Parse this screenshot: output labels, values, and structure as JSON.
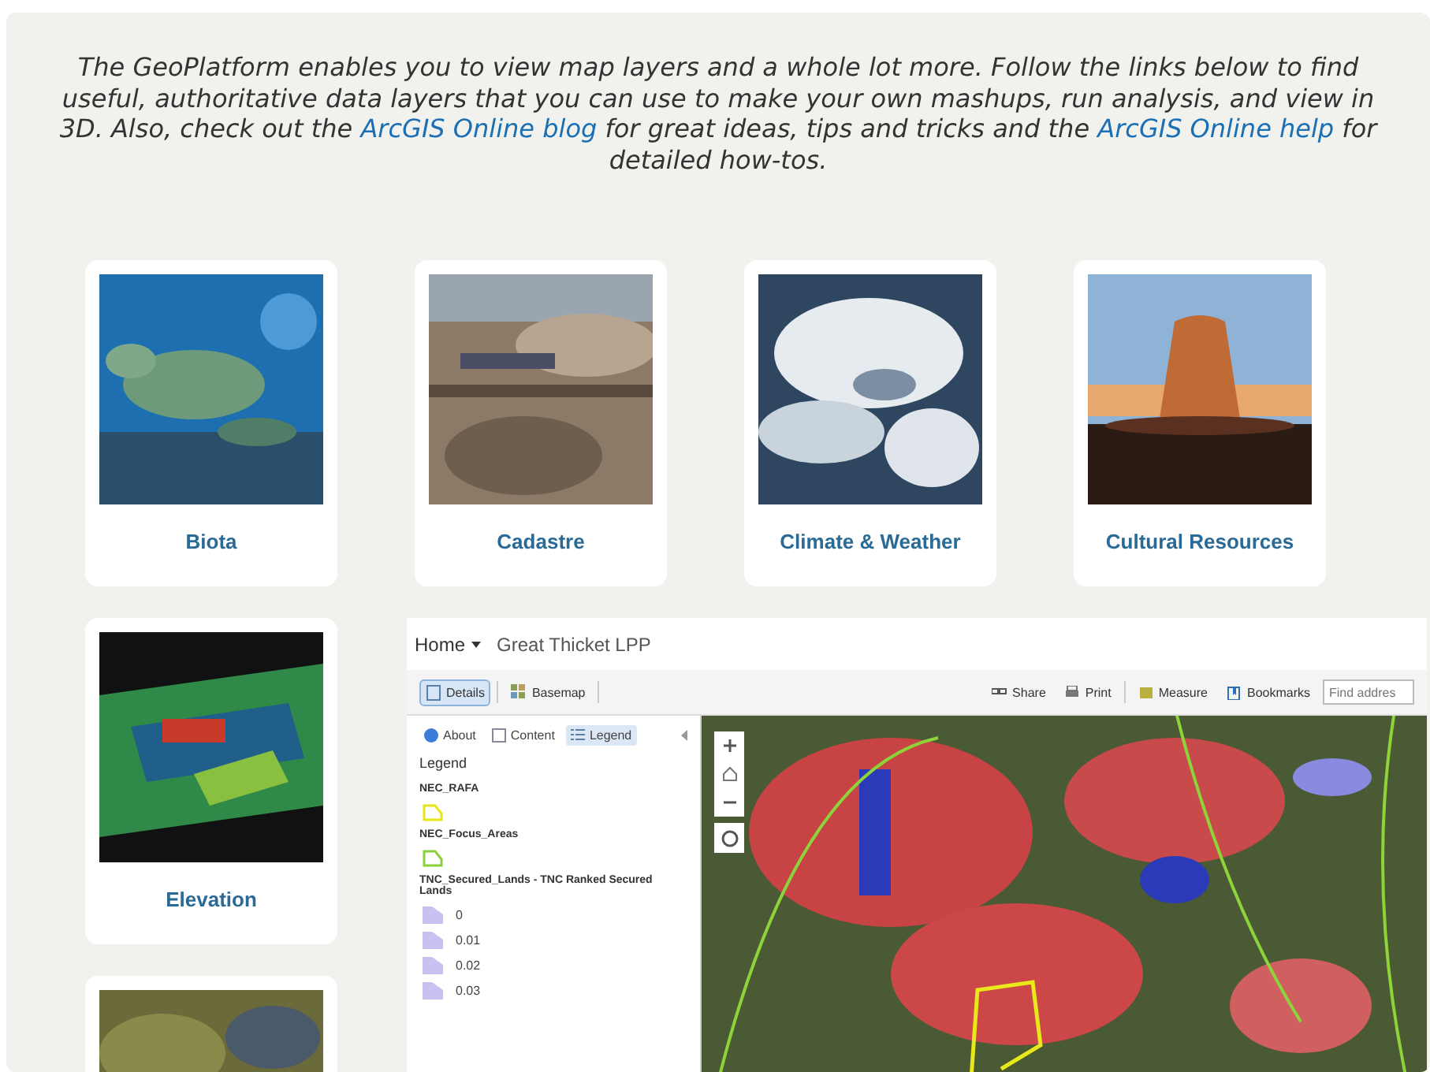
{
  "intro": [
    {
      "kind": "text",
      "text": "The GeoPlatform enables you to view map layers and a whole lot more. Follow the links below to find useful, authoritative data layers that you can use to make your own mashups, run analysis, and view in 3D. Also, check out the "
    },
    {
      "kind": "link",
      "text": "ArcGIS Online blog"
    },
    {
      "kind": "text",
      "text": " for great ideas, tips and tricks and the "
    },
    {
      "kind": "link",
      "text": "ArcGIS Online help"
    },
    {
      "kind": "text",
      "text": " for detailed how-tos."
    }
  ],
  "cards": [
    {
      "kind": "labelled",
      "label": "Biota"
    },
    {
      "kind": "labelled",
      "label": "Cadastre"
    },
    {
      "kind": "labelled",
      "label": "Climate & Weather"
    },
    {
      "kind": "labelled",
      "label": "Cultural Resources"
    },
    {
      "kind": "labelled",
      "label": "Elevation"
    },
    {
      "kind": "picture"
    }
  ],
  "viewer": {
    "home": "Home",
    "title": "Great Thicket LPP",
    "toolbar_left": [
      {
        "label": "Details",
        "selected": true
      },
      {
        "label": "Basemap",
        "selected": false
      }
    ],
    "toolbar_right": [
      "Share",
      "Print",
      "Measure",
      "Bookmarks"
    ],
    "search": {
      "placeholder": "Find addres"
    },
    "panel_tabs": [
      {
        "label": "About",
        "selected": false
      },
      {
        "label": "Content",
        "selected": false
      },
      {
        "label": "Legend",
        "selected": true
      }
    ],
    "legend_title": "Legend",
    "layers": [
      {
        "name": "NEC_RAFA",
        "items": [
          {
            "kind": "outline",
            "color": "#e6e619"
          }
        ]
      },
      {
        "name": "NEC_Focus_Areas",
        "items": [
          {
            "kind": "outline",
            "color": "#8ccf3a"
          }
        ]
      },
      {
        "name": "TNC_Secured_Lands - TNC Ranked Secured Lands",
        "items": [
          {
            "kind": "fill",
            "color": "#c9c2f0",
            "label": "0"
          },
          {
            "kind": "fill",
            "color": "#c9c2f0",
            "label": "0.01"
          },
          {
            "kind": "fill",
            "color": "#c9c2f0",
            "label": "0.02"
          },
          {
            "kind": "fill",
            "color": "#c9c2f0",
            "label": "0.03"
          }
        ]
      }
    ]
  }
}
